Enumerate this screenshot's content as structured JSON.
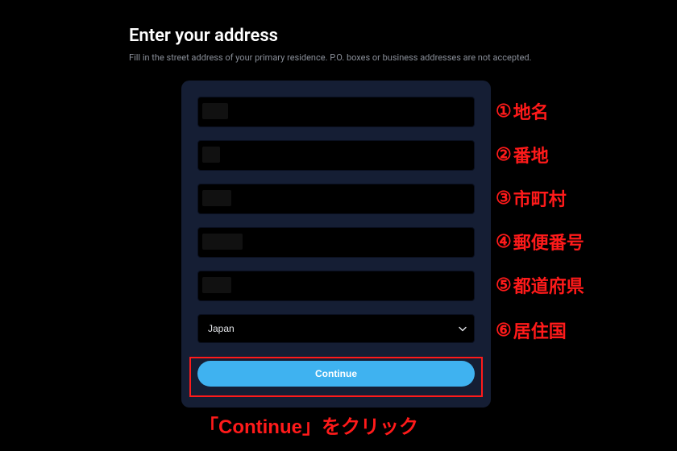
{
  "header": {
    "title": "Enter your address",
    "subtitle": "Fill in the street address of your primary residence. P.O. boxes or business addresses are not accepted."
  },
  "form": {
    "fields": [
      {
        "value": "",
        "placeholder": ""
      },
      {
        "value": "",
        "placeholder": ""
      },
      {
        "value": "",
        "placeholder": ""
      },
      {
        "value": "",
        "placeholder": ""
      },
      {
        "value": "",
        "placeholder": ""
      }
    ],
    "country": {
      "selected": "Japan"
    },
    "continue_label": "Continue"
  },
  "annotations": {
    "items": [
      {
        "num": "①",
        "label": "地名"
      },
      {
        "num": "②",
        "label": "番地"
      },
      {
        "num": "③",
        "label": "市町村"
      },
      {
        "num": "④",
        "label": "郵便番号"
      },
      {
        "num": "⑤",
        "label": "都道府県"
      },
      {
        "num": "⑥",
        "label": "居住国"
      }
    ],
    "instruction": "「Continue」をクリック"
  },
  "colors": {
    "accent": "#3fb2f0",
    "annotation": "#ff1a1a",
    "card_bg": "#151e34"
  }
}
